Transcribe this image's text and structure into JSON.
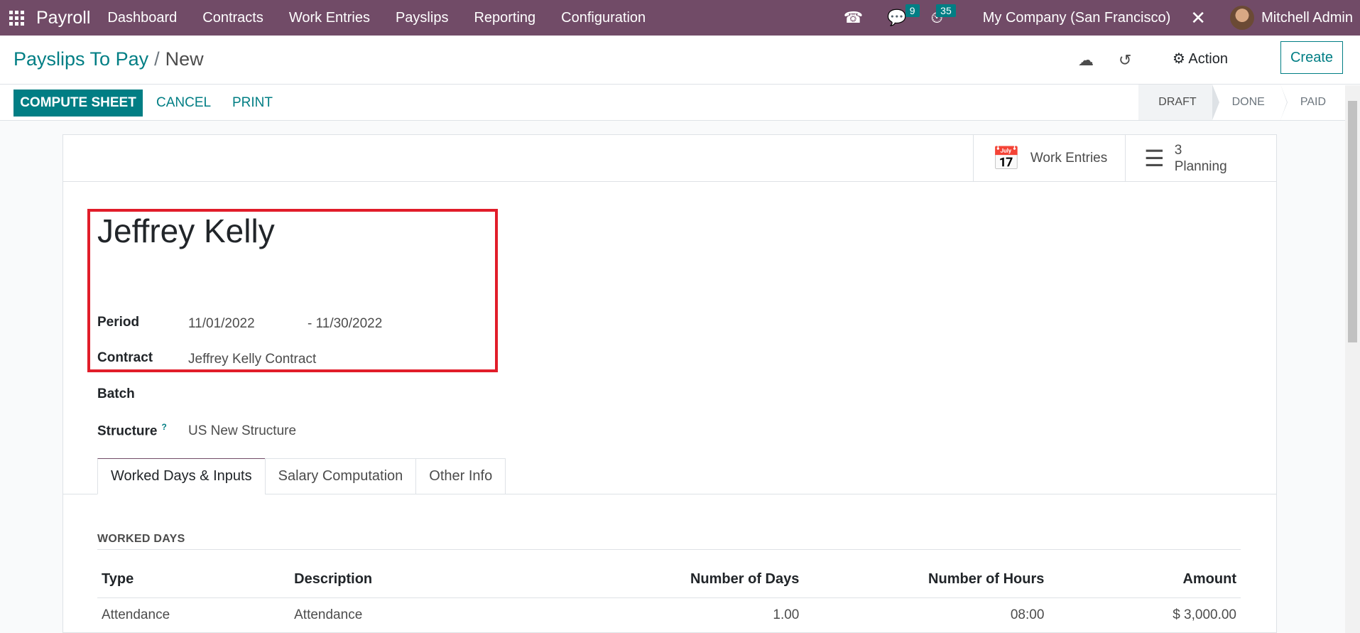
{
  "navbar": {
    "brand": "Payroll",
    "menu": [
      "Dashboard",
      "Contracts",
      "Work Entries",
      "Payslips",
      "Reporting",
      "Configuration"
    ],
    "messages_count": "9",
    "activities_count": "35",
    "company": "My Company (San Francisco)",
    "user": "Mitchell Admin"
  },
  "breadcrumb": {
    "parent": "Payslips To Pay",
    "separator": "/",
    "current": "New"
  },
  "control": {
    "action_label": "Action",
    "create_label": "Create",
    "compute_label": "COMPUTE SHEET",
    "cancel_label": "CANCEL",
    "print_label": "PRINT"
  },
  "statusbar": [
    "DRAFT",
    "DONE",
    "PAID"
  ],
  "smart_buttons": {
    "work_entries": "Work Entries",
    "planning_count": "3",
    "planning_label": "Planning"
  },
  "form": {
    "employee": "Jeffrey Kelly",
    "period_label": "Period",
    "period_from": "11/01/2022",
    "period_to": "- 11/30/2022",
    "contract_label": "Contract",
    "contract": "Jeffrey Kelly Contract",
    "batch_label": "Batch",
    "structure_label": "Structure",
    "structure_help": "?",
    "structure": "US New Structure"
  },
  "tabs": [
    "Worked Days & Inputs",
    "Salary Computation",
    "Other Info"
  ],
  "worked_days": {
    "title": "WORKED DAYS",
    "columns": [
      "Type",
      "Description",
      "Number of Days",
      "Number of Hours",
      "Amount"
    ],
    "rows": [
      {
        "type": "Attendance",
        "description": "Attendance",
        "days": "1.00",
        "hours": "08:00",
        "amount": "$ 3,000.00"
      }
    ]
  },
  "colors": {
    "brand": "#714b67",
    "accent": "#017e84",
    "highlight": "#e11d2a"
  }
}
